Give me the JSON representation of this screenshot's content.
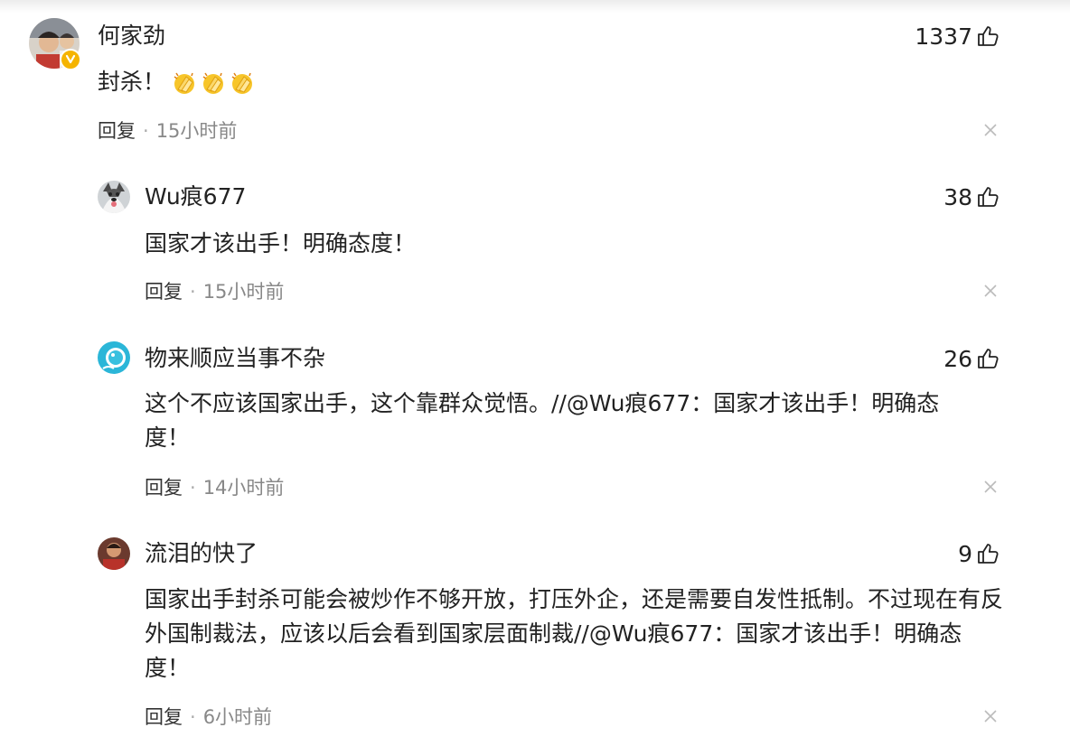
{
  "comments": [
    {
      "user": "何家劲",
      "likes": "1337",
      "text": "封杀！",
      "emoji": "clapping-hands-emoji",
      "reply_label": "回复",
      "time": "15小时前"
    },
    {
      "user": "Wu痕677",
      "likes": "38",
      "text": "国家才该出手！明确态度！",
      "reply_label": "回复",
      "time": "15小时前"
    },
    {
      "user": "物来顺应当事不杂",
      "likes": "26",
      "text": "这个不应该国家出手，这个靠群众觉悟。//@Wu痕677：国家才该出手！明确态度！",
      "reply_label": "回复",
      "time": "14小时前"
    },
    {
      "user": "流泪的快了",
      "likes": "9",
      "text": "国家出手封杀可能会被炒作不够开放，打压外企，还是需要自发性抵制。不过现在有反外国制裁法，应该以后会看到国家层面制裁//@Wu痕677：国家才该出手！明确态度！",
      "reply_label": "回复",
      "time": "6小时前"
    }
  ],
  "icons": {
    "like": "thumbs-up-icon",
    "close": "close-icon",
    "verified": "verified-badge-icon"
  },
  "colors": {
    "verified_badge": "#f5b400",
    "meta_text": "#888888",
    "body_text": "#222222"
  }
}
